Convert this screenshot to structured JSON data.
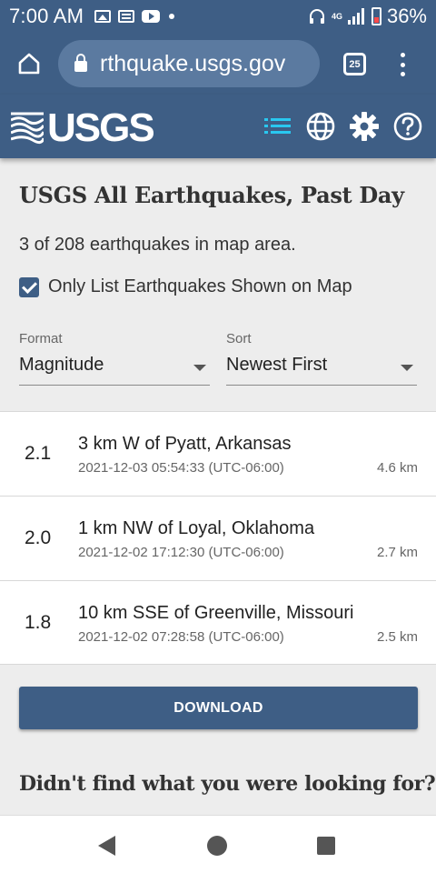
{
  "status_bar": {
    "time": "7:00 AM",
    "network": "4G",
    "battery": "36%"
  },
  "browser": {
    "url": "rthquake.usgs.gov",
    "tab_count": "25"
  },
  "app": {
    "logo_text": "USGS",
    "header_icons": [
      "list-icon",
      "globe-icon",
      "gear-icon",
      "help-icon"
    ]
  },
  "page": {
    "title": "USGS All Earthquakes, Past Day",
    "count_text": "3 of 208 earthquakes in map area.",
    "checkbox_label": "Only List Earthquakes Shown on Map",
    "checkbox_checked": true,
    "format": {
      "label": "Format",
      "value": "Magnitude"
    },
    "sort": {
      "label": "Sort",
      "value": "Newest First"
    }
  },
  "earthquakes": [
    {
      "mag": "2.1",
      "place": "3 km W of Pyatt, Arkansas",
      "time": "2021-12-03 05:54:33 (UTC-06:00)",
      "depth": "4.6 km"
    },
    {
      "mag": "2.0",
      "place": "1 km NW of Loyal, Oklahoma",
      "time": "2021-12-02 17:12:30 (UTC-06:00)",
      "depth": "2.7 km"
    },
    {
      "mag": "1.8",
      "place": "10 km SSE of Greenville, Missouri",
      "time": "2021-12-02 07:28:58 (UTC-06:00)",
      "depth": "2.5 km"
    }
  ],
  "download_label": "DOWNLOAD",
  "footer_heading": "Didn't find what you were looking for?",
  "colors": {
    "primary": "#3e5e85",
    "url_pill": "#5b7aa0",
    "active_icon": "#29c8f0",
    "background": "#ededed"
  }
}
